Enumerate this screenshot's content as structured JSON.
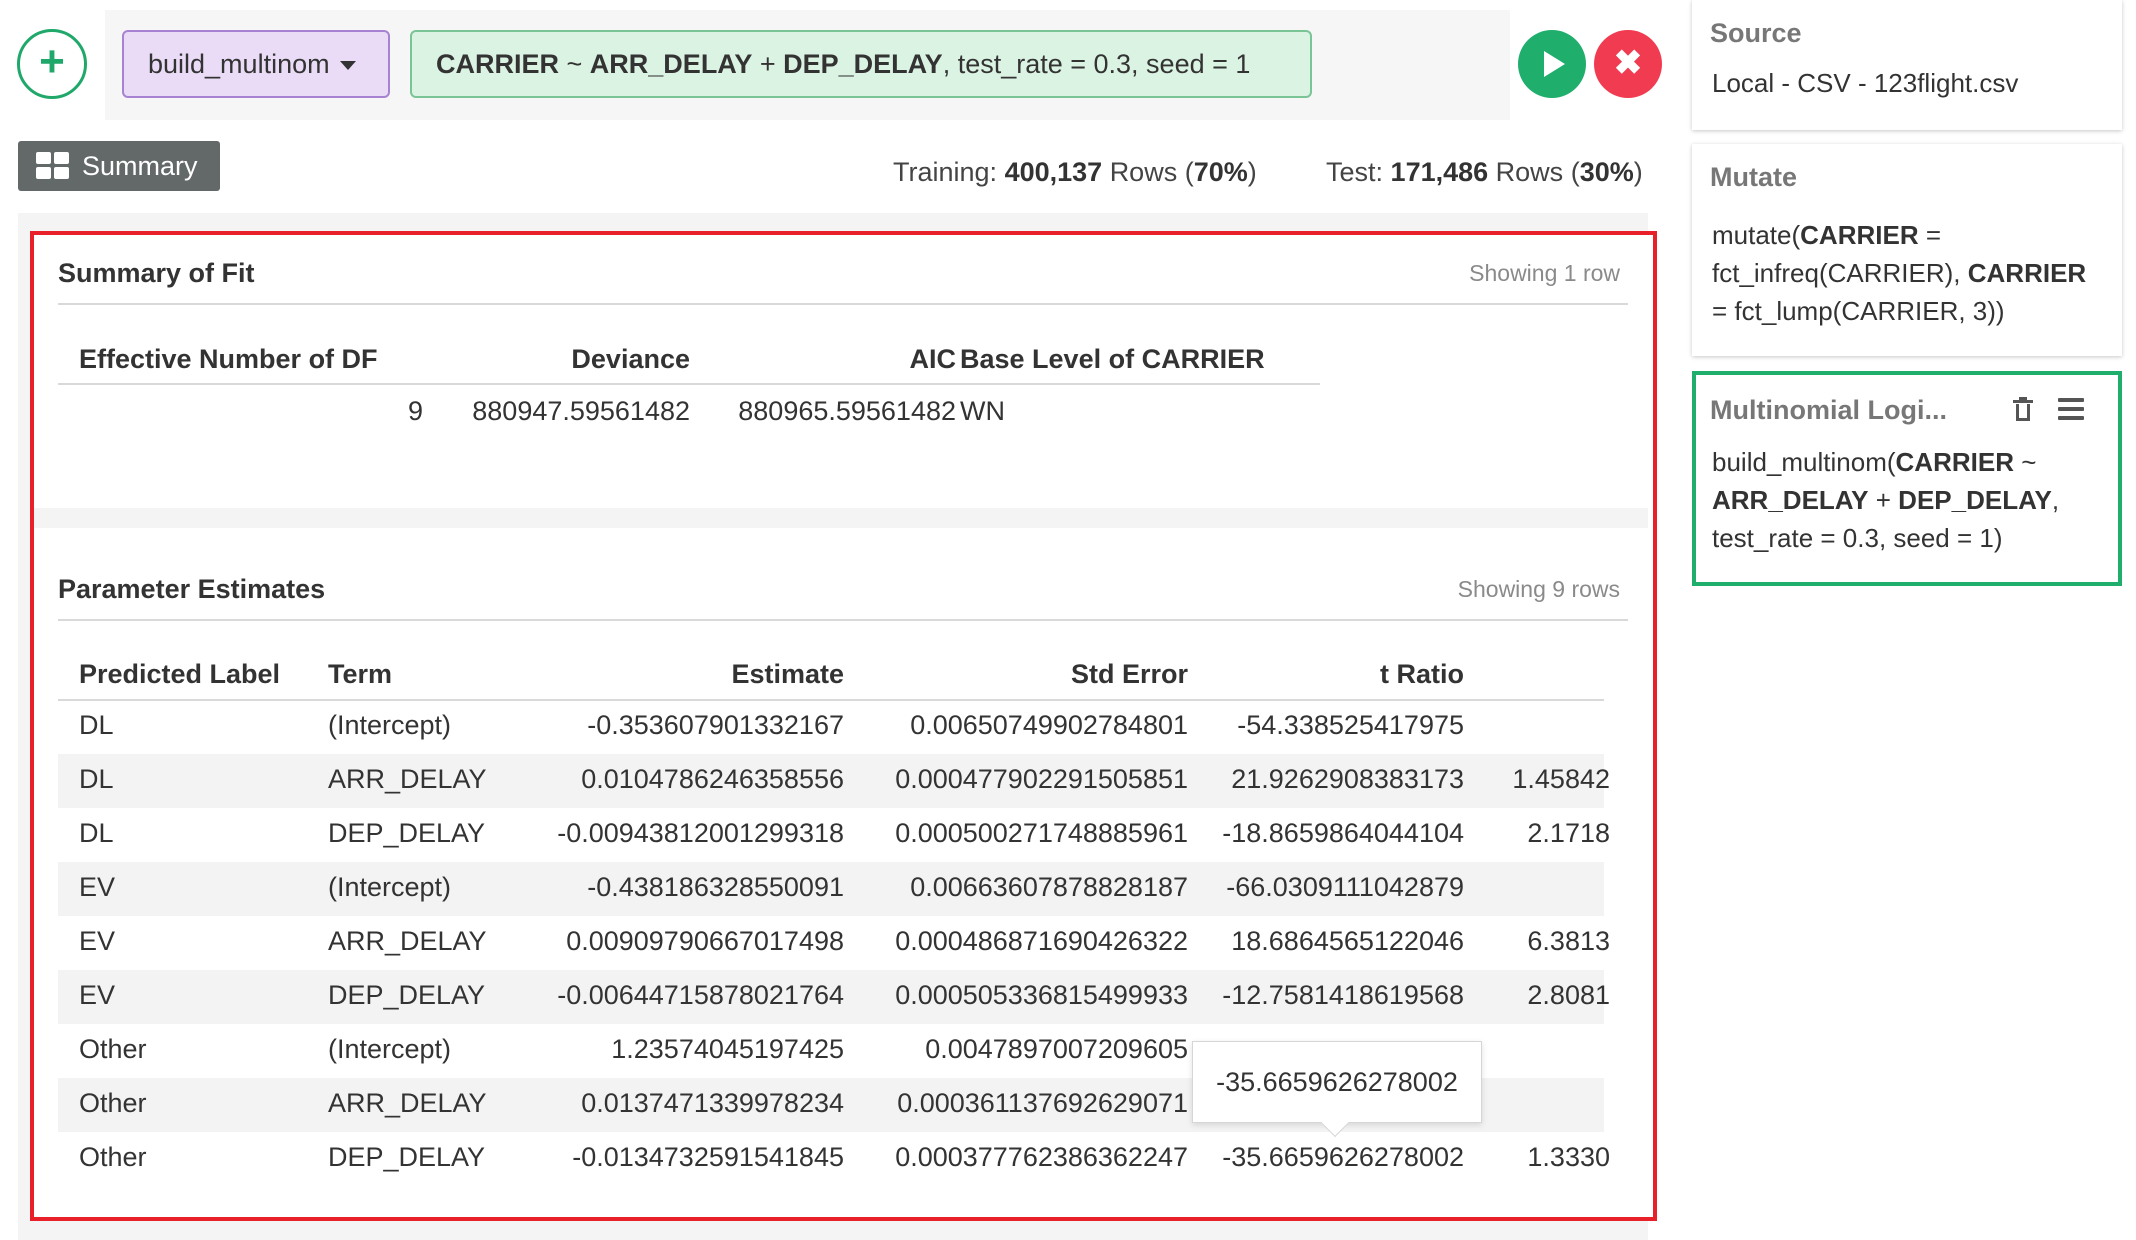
{
  "command": {
    "add_label": "+",
    "function_name": "build_multinom",
    "arg_parts": [
      {
        "text": "CARRIER",
        "bold": true
      },
      {
        "text": " ~ ",
        "bold": false
      },
      {
        "text": "ARR_DELAY",
        "bold": true
      },
      {
        "text": " + ",
        "bold": false
      },
      {
        "text": "DEP_DELAY",
        "bold": true
      },
      {
        "text": ", test_rate = 0.3, seed = 1",
        "bold": false
      }
    ],
    "run_label": "Run",
    "cancel_label": "✖"
  },
  "tab": {
    "summary_label": "Summary"
  },
  "counts": {
    "training_label": "Training:",
    "training_rows": "400,137",
    "training_unit": "Rows",
    "training_pct": "70%",
    "test_label": "Test:",
    "test_rows": "171,486",
    "test_unit": "Rows",
    "test_pct": "30%"
  },
  "fit": {
    "title": "Summary of Fit",
    "showing": "Showing 1 row",
    "columns": [
      "Effective Number of DF",
      "Deviance",
      "AIC",
      "Base Level of CARRIER"
    ],
    "row": [
      "9",
      "880947.59561482",
      "880965.59561482",
      "WN"
    ]
  },
  "params": {
    "title": "Parameter Estimates",
    "showing": "Showing 9 rows",
    "columns": [
      "Predicted Label",
      "Term",
      "Estimate",
      "Std Error",
      "t Ratio"
    ],
    "rows": [
      [
        "DL",
        "(Intercept)",
        "-0.353607901332167",
        "0.00650749902784801",
        "-54.338525417975",
        ""
      ],
      [
        "DL",
        "ARR_DELAY",
        "0.0104786246358556",
        "0.000477902291505851",
        "21.9262908383173",
        "1.45842"
      ],
      [
        "DL",
        "DEP_DELAY",
        "-0.00943812001299318",
        "0.000500271748885961",
        "-18.8659864044104",
        "2.1718"
      ],
      [
        "EV",
        "(Intercept)",
        "-0.438186328550091",
        "0.00663607878828187",
        "-66.0309111042879",
        ""
      ],
      [
        "EV",
        "ARR_DELAY",
        "0.00909790667017498",
        "0.000486871690426322",
        "18.6864565122046",
        "6.3813"
      ],
      [
        "EV",
        "DEP_DELAY",
        "-0.00644715878021764",
        "0.000505336815499933",
        "-12.7581418619568",
        "2.8081"
      ],
      [
        "Other",
        "(Intercept)",
        "1.23574045197425",
        "0.0047897007209605",
        "",
        ""
      ],
      [
        "Other",
        "ARR_DELAY",
        "0.0137471339978234",
        "0.000361137692629071",
        "",
        ""
      ],
      [
        "Other",
        "DEP_DELAY",
        "-0.0134732591541845",
        "0.000377762386362247",
        "-35.6659626278002",
        "1.3330"
      ]
    ],
    "tooltip": "-35.6659626278002"
  },
  "pipeline": {
    "source": {
      "title": "Source",
      "body": "Local - CSV - 123flight.csv"
    },
    "mutate": {
      "title": "Mutate",
      "lines": [
        [
          {
            "text": "mutate(",
            "bold": false
          },
          {
            "text": "CARRIER",
            "bold": true
          },
          {
            "text": " =",
            "bold": false
          }
        ],
        [
          {
            "text": "fct_infreq(CARRIER), ",
            "bold": false
          },
          {
            "text": "CARRIER",
            "bold": true
          }
        ],
        [
          {
            "text": "= fct_lump(CARRIER, 3))",
            "bold": false
          }
        ]
      ]
    },
    "multinom": {
      "title": "Multinomial Logi...",
      "lines": [
        [
          {
            "text": "build_multinom(",
            "bold": false
          },
          {
            "text": "CARRIER",
            "bold": true
          },
          {
            "text": " ~",
            "bold": false
          }
        ],
        [
          {
            "text": "ARR_DELAY",
            "bold": true
          },
          {
            "text": " + ",
            "bold": false
          },
          {
            "text": "DEP_DELAY",
            "bold": true
          },
          {
            "text": ",",
            "bold": false
          }
        ],
        [
          {
            "text": "test_rate = 0.3, seed = 1)",
            "bold": false
          }
        ]
      ]
    }
  },
  "colors": {
    "accent_green": "#1fae6c",
    "cancel_red": "#f03b50",
    "highlight_red": "#e8202a"
  }
}
